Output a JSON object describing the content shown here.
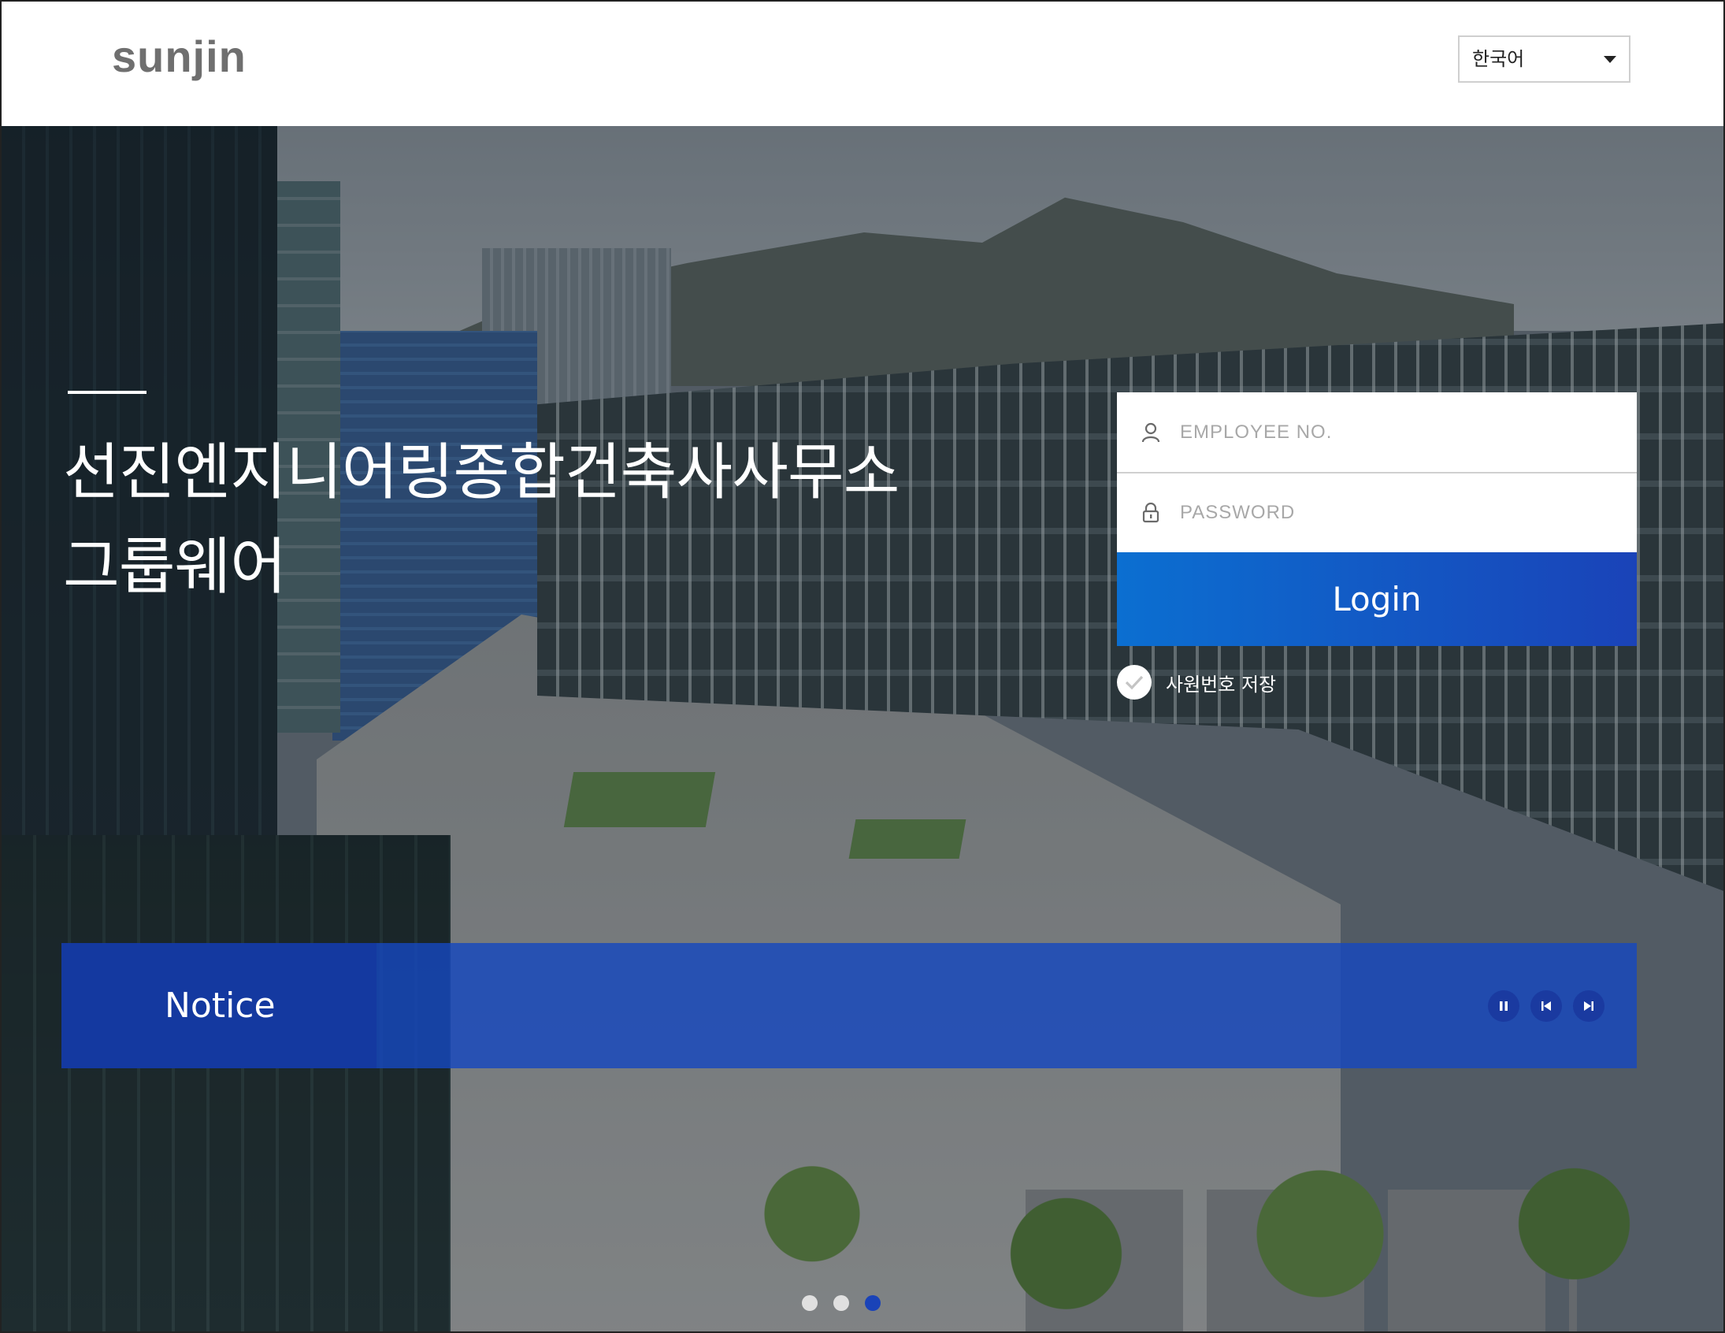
{
  "header": {
    "logo_text": "SUNJIN",
    "language": {
      "selected": "한국어"
    }
  },
  "hero": {
    "headline_line1": "선진엔지니어링종합건축사사무소",
    "headline_line2": "그룹웨어"
  },
  "login": {
    "employee_placeholder": "EMPLOYEE NO.",
    "password_placeholder": "PASSWORD",
    "login_label": "Login",
    "remember_label": "사원번호 저장",
    "remember_checked": true
  },
  "notice": {
    "title": "Notice",
    "controls": [
      "pause-icon",
      "prev-icon",
      "next-icon"
    ]
  },
  "slider": {
    "slide_count": 3,
    "active_index": 3
  },
  "colors": {
    "login_button_start": "#0b6fd1",
    "login_button_end": "#1a43b8",
    "notice_bg": "#1648be",
    "dot_active": "#1a43b8",
    "dot_inactive": "#e0e0e0"
  }
}
